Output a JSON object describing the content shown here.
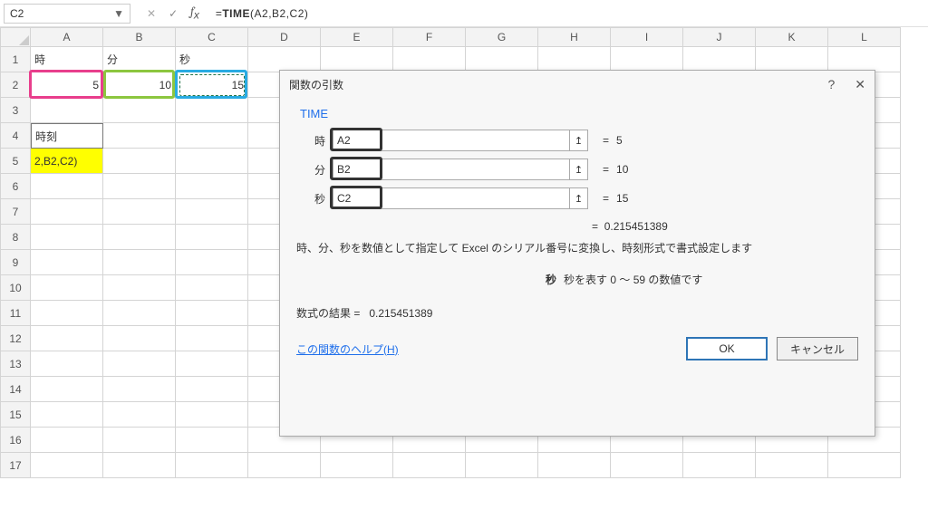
{
  "namebox": {
    "value": "C2"
  },
  "formula": {
    "prefix": "=",
    "fn": "TIME",
    "args": "(A2,B2,C2)"
  },
  "columns": [
    "A",
    "B",
    "C",
    "D",
    "E",
    "F",
    "G",
    "H",
    "I",
    "J",
    "K",
    "L"
  ],
  "sheet": {
    "a1": "時",
    "b1": "分",
    "c1": "秒",
    "a2": "5",
    "b2": "10",
    "c2": "15",
    "a4": "時刻",
    "a5": "2,B2,C2)"
  },
  "dialog": {
    "title": "関数の引数",
    "fn": "TIME",
    "args": {
      "hour": {
        "label": "時",
        "value": "A2",
        "result": "5"
      },
      "minute": {
        "label": "分",
        "value": "B2",
        "result": "10"
      },
      "second": {
        "label": "秒",
        "value": "C2",
        "result": "15"
      }
    },
    "eq": "=",
    "result_value": "0.215451389",
    "description": "時、分、秒を数値として指定して Excel のシリアル番号に変換し、時刻形式で書式設定します",
    "arg_help_label": "秒",
    "arg_help_text": "秒を表す 0 ～ 59 の数値です",
    "formula_result_label": "数式の結果 =",
    "formula_result_value": "0.215451389",
    "help_link": "この関数のヘルプ(H)",
    "ok": "OK",
    "cancel": "キャンセル"
  }
}
